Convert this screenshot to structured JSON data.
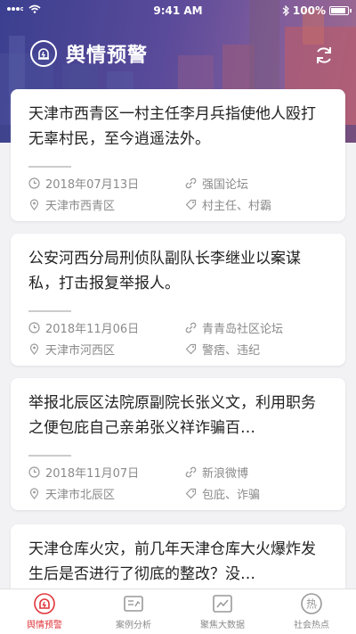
{
  "status": {
    "time": "9:41 AM",
    "battery": "100%"
  },
  "header": {
    "title": "舆情预警"
  },
  "cards": [
    {
      "title": "天津市西青区一村主任李月兵指使他人殴打无辜村民，至今逍遥法外。",
      "date": "2018年07月13日",
      "source": "强国论坛",
      "location": "天津市西青区",
      "tags": "村主任、村霸"
    },
    {
      "title": "公安河西分局刑侦队副队长李继业以案谋私，打击报复举报人。",
      "date": "2018年11月06日",
      "source": "青青岛社区论坛",
      "location": "天津市河西区",
      "tags": "警痞、违纪"
    },
    {
      "title": "举报北辰区法院原副院长张义文，利用职务之便包庇自己亲弟张义祥诈骗百…",
      "date": "2018年11月07日",
      "source": "新浪微博",
      "location": "天津市北辰区",
      "tags": "包庇、诈骗"
    },
    {
      "title": "天津仓库火灾，前几年天津仓库大火爆炸发生后是否进行了彻底的整改？没…"
    }
  ],
  "tabs": [
    {
      "label": "舆情预警",
      "icon": "alarm-icon"
    },
    {
      "label": "案例分析",
      "icon": "case-analysis-icon"
    },
    {
      "label": "聚焦大数据",
      "icon": "chart-icon"
    },
    {
      "label": "社会热点",
      "icon": "hot-icon"
    }
  ],
  "colors": {
    "accent": "#e0343b",
    "meta": "#8a8a8a",
    "banner": "#5a4a9a"
  }
}
